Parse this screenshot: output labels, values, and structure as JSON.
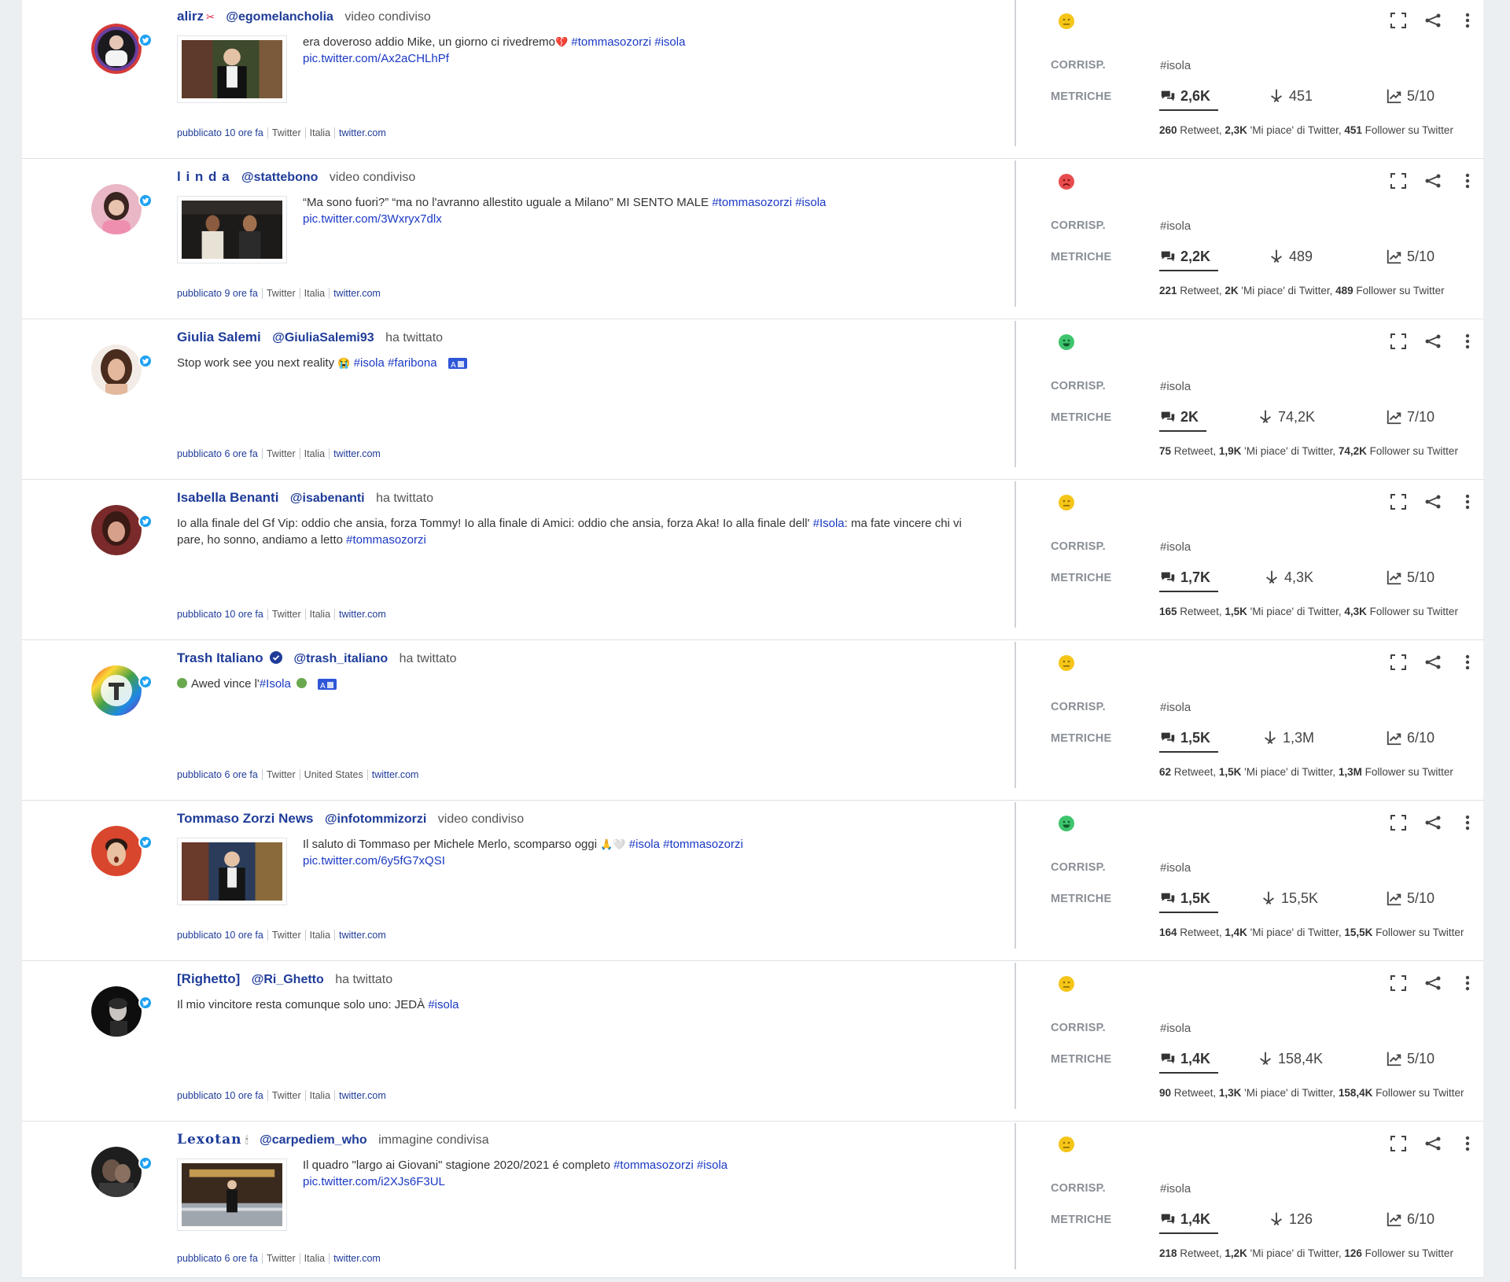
{
  "colors": {
    "link": "#1a39c4",
    "name": "#1f3c99",
    "twitter_badge": "#1da1f2",
    "sentiment_neutral": "#f5c518",
    "sentiment_negative": "#e84c4c",
    "sentiment_positive": "#3ec46d"
  },
  "labels": {
    "corrisp": "CORRISP.",
    "metriche": "METRICHE",
    "retweet": "Retweet,",
    "likes": "'Mi piace' di Twitter,",
    "followers": "Follower su Twitter"
  },
  "posts": [
    {
      "name": "alirz",
      "name_suffix": "✂",
      "handle": "@egomelancholia",
      "action": "video condiviso",
      "text": "era doveroso addio Mike, un giorno ci rivedremo",
      "emoji": "💔",
      "hashtags": "#tommasozorzi #isola",
      "link": "pic.twitter.com/Ax2aCHLhPf",
      "published": "pubblicato 10 ore fa",
      "source": "Twitter",
      "country": "Italia",
      "domain": "twitter.com",
      "sentiment": "neutral",
      "corrisp": "#isola",
      "comments": "2,6K",
      "reach": "451",
      "score": "5/10",
      "retweets": "260",
      "likes": "2,3K",
      "followers": "451"
    },
    {
      "name": "l i n d a",
      "handle": "@stattebono",
      "action": "video condiviso",
      "text": "“Ma sono fuori?” “ma no l'avranno allestito uguale a Milano” MI SENTO MALE",
      "hashtags": "#tommasozorzi #isola",
      "link": "pic.twitter.com/3Wxryx7dlx",
      "published": "pubblicato 9 ore fa",
      "source": "Twitter",
      "country": "Italia",
      "domain": "twitter.com",
      "sentiment": "negative",
      "corrisp": "#isola",
      "comments": "2,2K",
      "reach": "489",
      "score": "5/10",
      "retweets": "221",
      "likes": "2K",
      "followers": "489"
    },
    {
      "name": "Giulia Salemi",
      "handle": "@GiuliaSalemi93",
      "action": "ha twittato",
      "text": "Stop work see you next reality",
      "emoji": "😭",
      "hashtags": "#isola #faribona",
      "published": "pubblicato 6 ore fa",
      "source": "Twitter",
      "country": "Italia",
      "domain": "twitter.com",
      "sentiment": "positive",
      "corrisp": "#isola",
      "comments": "2K",
      "reach": "74,2K",
      "score": "7/10",
      "retweets": "75",
      "likes": "1,9K",
      "followers": "74,2K"
    },
    {
      "name": "Isabella Benanti",
      "handle": "@isabenanti",
      "action": "ha twittato",
      "text_a": "Io alla finale del Gf Vip: oddio che ansia, forza Tommy! Io alla finale di Amici: oddio che ansia, forza Aka! Io alla finale dell'",
      "hashtag_mid": "#Isola",
      "text_b": ": ma fate vincere chi vi pare, ho sonno, andiamo a letto",
      "hashtag_end": "#tommasozorzi",
      "published": "pubblicato 10 ore fa",
      "source": "Twitter",
      "country": "Italia",
      "domain": "twitter.com",
      "sentiment": "neutral",
      "corrisp": "#isola",
      "comments": "1,7K",
      "reach": "4,3K",
      "score": "5/10",
      "retweets": "165",
      "likes": "1,5K",
      "followers": "4,3K"
    },
    {
      "name": "Trash Italiano",
      "handle": "@trash_italiano",
      "action": "ha twittato",
      "text": "Awed vince l'",
      "hashtags": "#Isola",
      "published": "pubblicato 6 ore fa",
      "source": "Twitter",
      "country": "United States",
      "domain": "twitter.com",
      "sentiment": "neutral",
      "corrisp": "#isola",
      "comments": "1,5K",
      "reach": "1,3M",
      "score": "6/10",
      "retweets": "62",
      "likes": "1,5K",
      "followers": "1,3M"
    },
    {
      "name": "Tommaso Zorzi News",
      "handle": "@infotommizorzi",
      "action": "video condiviso",
      "text": "Il saluto di Tommaso per Michele Merlo, scomparso oggi",
      "emoji": "🙏🤍",
      "hashtags": "#isola #tommasozorzi",
      "link": "pic.twitter.com/6y5fG7xQSI",
      "published": "pubblicato 10 ore fa",
      "source": "Twitter",
      "country": "Italia",
      "domain": "twitter.com",
      "sentiment": "positive",
      "corrisp": "#isola",
      "comments": "1,5K",
      "reach": "15,5K",
      "score": "5/10",
      "retweets": "164",
      "likes": "1,4K",
      "followers": "15,5K"
    },
    {
      "name": "[Righetto]",
      "handle": "@Ri_Ghetto",
      "action": "ha twittato",
      "text": "Il mio vincitore resta comunque solo uno: JEDÀ",
      "hashtags": "#isola",
      "published": "pubblicato 10 ore fa",
      "source": "Twitter",
      "country": "Italia",
      "domain": "twitter.com",
      "sentiment": "neutral",
      "corrisp": "#isola",
      "comments": "1,4K",
      "reach": "158,4K",
      "score": "5/10",
      "retweets": "90",
      "likes": "1,3K",
      "followers": "158,4K"
    },
    {
      "name": "Lexotan",
      "name_suffix": "🕯",
      "handle": "@carpediem_who",
      "action": "immagine condivisa",
      "text": "Il quadro \"largo ai Giovani\" stagione 2020/2021 é completo",
      "hashtags": "#tommasozorzi #isola",
      "link": "pic.twitter.com/i2XJs6F3UL",
      "published": "pubblicato 6 ore fa",
      "source": "Twitter",
      "country": "Italia",
      "domain": "twitter.com",
      "sentiment": "neutral",
      "corrisp": "#isola",
      "comments": "1,4K",
      "reach": "126",
      "score": "6/10",
      "retweets": "218",
      "likes": "1,2K",
      "followers": "126"
    }
  ]
}
